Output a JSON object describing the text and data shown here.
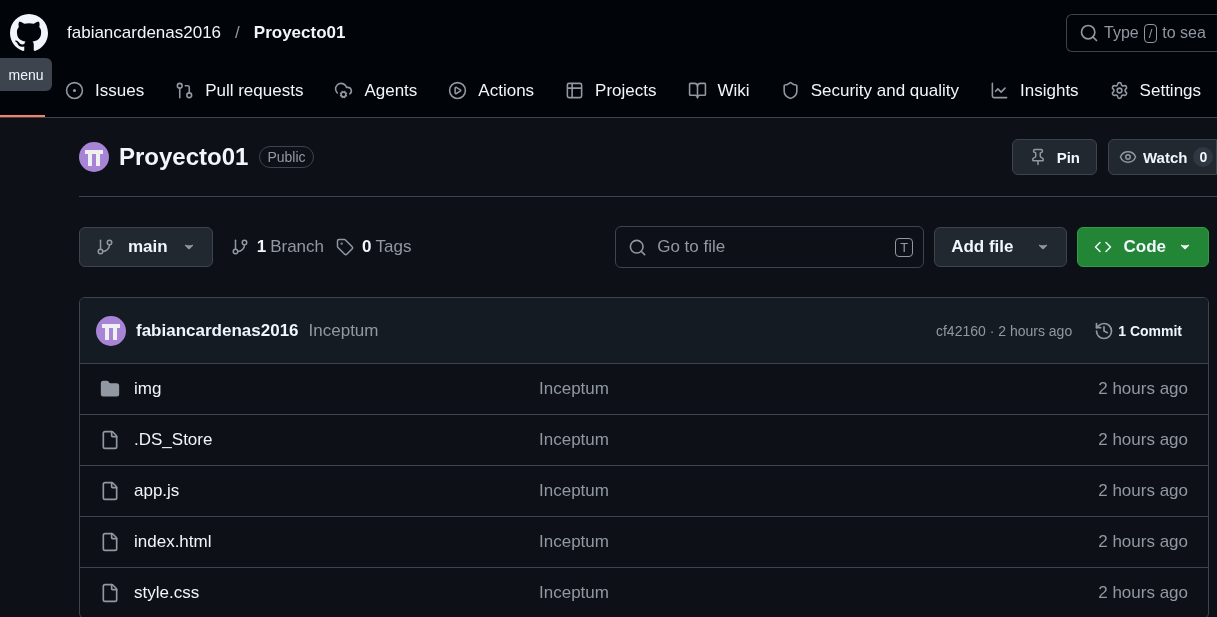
{
  "header": {
    "owner": "fabiancardenas2016",
    "separator": "/",
    "repo": "Proyecto01",
    "search": {
      "placeholder_start": "Type",
      "key": "/",
      "placeholder_end": "to sea"
    }
  },
  "tooltip": "menu",
  "nav": {
    "first_tab_selected": true,
    "tabs": [
      {
        "kind": "issues",
        "label": "Issues",
        "selected": false
      },
      {
        "kind": "pulls",
        "label": "Pull requests",
        "selected": false
      },
      {
        "kind": "agents",
        "label": "Agents",
        "selected": false
      },
      {
        "kind": "actions",
        "label": "Actions",
        "selected": false
      },
      {
        "kind": "projects",
        "label": "Projects",
        "selected": false
      },
      {
        "kind": "wiki",
        "label": "Wiki",
        "selected": false
      },
      {
        "kind": "security",
        "label": "Security and quality",
        "selected": false
      },
      {
        "kind": "insights",
        "label": "Insights",
        "selected": false
      },
      {
        "kind": "settings",
        "label": "Settings",
        "selected": false
      }
    ]
  },
  "repo": {
    "name": "Proyecto01",
    "visibility": "Public",
    "pin": "Pin",
    "watch": "Watch",
    "watch_count": "0"
  },
  "toolbar": {
    "branch": "main",
    "branch_count": "1",
    "branch_label": "Branch",
    "tag_count": "0",
    "tag_label": "Tags",
    "go_to_file": {
      "placeholder": "Go to file",
      "key": "T"
    },
    "add_file": "Add file",
    "code": "Code"
  },
  "commit": {
    "author": "fabiancardenas2016",
    "message": "Inceptum",
    "hash_time": "cf42160 · 2 hours ago",
    "count": "1 Commit"
  },
  "files": [
    {
      "kind": "folder",
      "name": "img",
      "message": "Inceptum",
      "time": "2 hours ago"
    },
    {
      "kind": "file",
      "name": ".DS_Store",
      "message": "Inceptum",
      "time": "2 hours ago"
    },
    {
      "kind": "file",
      "name": "app.js",
      "message": "Inceptum",
      "time": "2 hours ago"
    },
    {
      "kind": "file",
      "name": "index.html",
      "message": "Inceptum",
      "time": "2 hours ago"
    },
    {
      "kind": "file",
      "name": "style.css",
      "message": "Inceptum",
      "time": "2 hours ago"
    }
  ]
}
